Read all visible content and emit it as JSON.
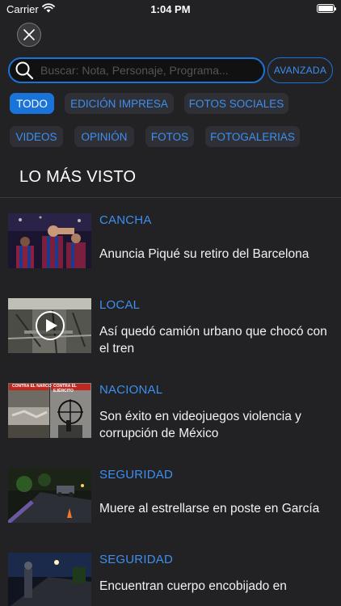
{
  "status": {
    "carrier": "Carrier",
    "time": "1:04 PM"
  },
  "search": {
    "placeholder": "Buscar: Nota, Personaje, Programa...",
    "advanced_label": "AVANZADA"
  },
  "filters": [
    {
      "label": "TODO",
      "active": true
    },
    {
      "label": "EDICIÓN IMPRESA",
      "active": false
    },
    {
      "label": "FOTOS SOCIALES",
      "active": false
    },
    {
      "label": "VIDEOS",
      "active": false
    },
    {
      "label": "OPINIÓN",
      "active": false
    },
    {
      "label": "FOTOS",
      "active": false
    },
    {
      "label": "FOTOGALERIAS",
      "active": false
    }
  ],
  "section_title": "LO MÁS VISTO",
  "articles": [
    {
      "category": "CANCHA",
      "headline": "Anuncia Piqué su retiro del Barcelona",
      "thumb": "soccer-players-image"
    },
    {
      "category": "LOCAL",
      "headline": "Así quedó camión urbano que chocó con el tren",
      "thumb": "bus-interior-video"
    },
    {
      "category": "NACIONAL",
      "headline": "Son éxito en videojuegos violencia y corrupción de México",
      "thumb": "videogame-screens-image",
      "thumb_text": [
        "CONTRA EL NARCO",
        "CONTRA EL EJÉRCITO"
      ]
    },
    {
      "category": "SEGURIDAD",
      "headline": "Muere al estrellarse en poste en García",
      "thumb": "night-crash-scene-image"
    },
    {
      "category": "SEGURIDAD",
      "headline": "Encuentran cuerpo encobijado en",
      "thumb": "night-street-image"
    }
  ],
  "colors": {
    "accent": "#1a73d9",
    "accent_text": "#3d8ff0",
    "background": "#222224",
    "chip_bg": "#2e3036"
  }
}
